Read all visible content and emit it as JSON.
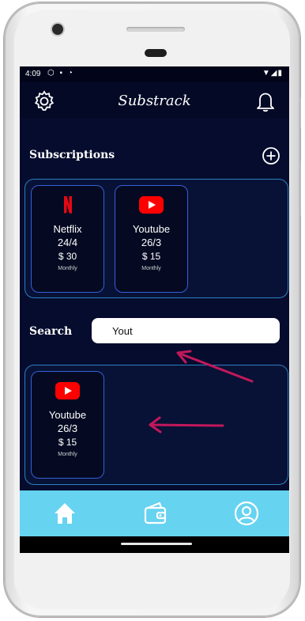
{
  "status_bar": {
    "time": "4:09"
  },
  "app": {
    "title": "Substrack"
  },
  "subscriptions": {
    "heading": "Subscriptions",
    "items": [
      {
        "name": "Netflix",
        "date": "24/4",
        "price": "$ 30",
        "cycle": "Monthly",
        "logo": "netflix-logo"
      },
      {
        "name": "Youtube",
        "date": "26/3",
        "price": "$ 15",
        "cycle": "Monthly",
        "logo": "youtube-logo"
      }
    ]
  },
  "search": {
    "label": "Search",
    "value": "Yout",
    "results": [
      {
        "name": "Youtube",
        "date": "26/3",
        "price": "$ 15",
        "cycle": "Monthly",
        "logo": "youtube-logo"
      }
    ]
  },
  "nav": {
    "items": [
      "home-icon",
      "wallet-icon",
      "profile-icon"
    ]
  },
  "colors": {
    "screen_bg": "#060c2e",
    "nav_bg": "#66d3f0",
    "arrow": "#c2185b",
    "netflix_red": "#e50914",
    "youtube_red": "#ff0000"
  }
}
